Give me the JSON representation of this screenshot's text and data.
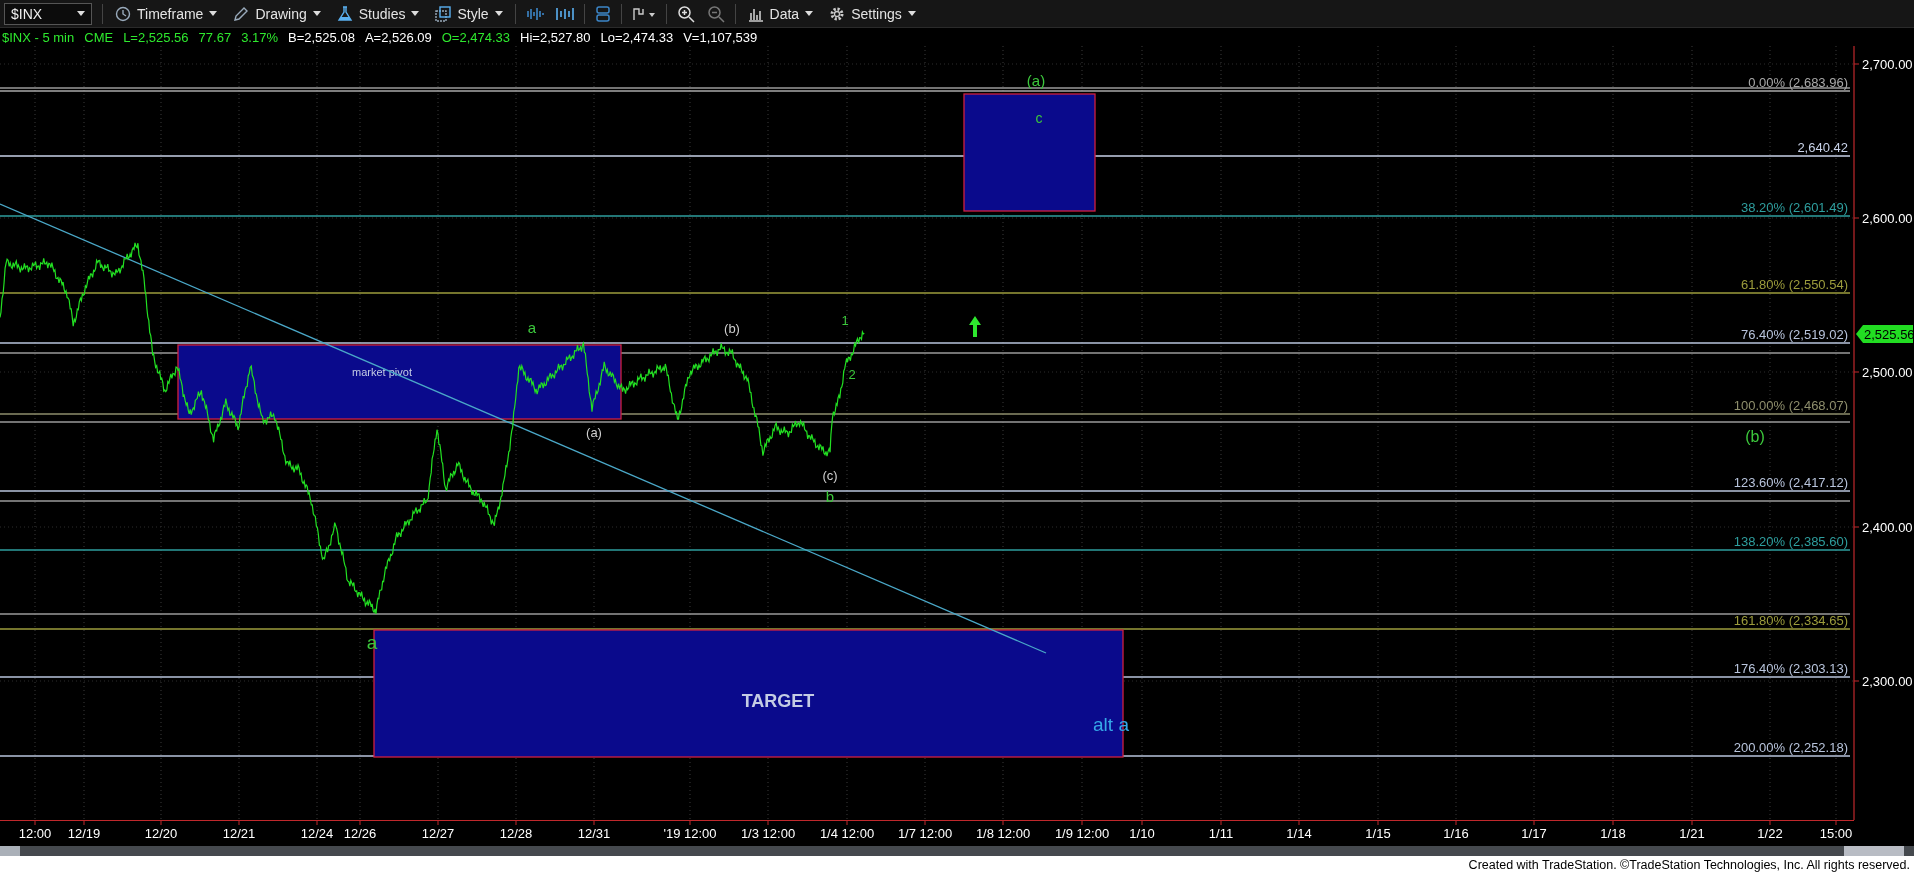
{
  "toolbar": {
    "symbol": "$INX",
    "menus": [
      {
        "label": "Timeframe"
      },
      {
        "label": "Drawing"
      },
      {
        "label": "Studies"
      },
      {
        "label": "Style"
      },
      {
        "label": "Data"
      },
      {
        "label": "Settings"
      }
    ]
  },
  "quote": [
    {
      "text": "$INX - 5 min",
      "color": "#2ee82e"
    },
    {
      "text": "CME",
      "color": "#2ee82e"
    },
    {
      "text": "L=2,525.56",
      "color": "#2ee82e"
    },
    {
      "text": "77.67",
      "color": "#2ee82e"
    },
    {
      "text": "3.17%",
      "color": "#2ee82e"
    },
    {
      "text": "B=2,525.08",
      "color": "#ffffff"
    },
    {
      "text": "A=2,526.09",
      "color": "#ffffff"
    },
    {
      "text": "O=2,474.33",
      "color": "#2ee82e"
    },
    {
      "text": "Hi=2,527.80",
      "color": "#ffffff"
    },
    {
      "text": "Lo=2,474.33",
      "color": "#ffffff"
    },
    {
      "text": "V=1,107,539",
      "color": "#ffffff"
    }
  ],
  "chart": {
    "fib_levels": [
      {
        "label": "0.00% (2,683.96)",
        "color": "#a8a8a8"
      },
      {
        "label": "2,640.42",
        "color": "#c8d2e8"
      },
      {
        "label": "38.20% (2,601.49)",
        "color": "#2e9e9e"
      },
      {
        "label": "61.80% (2,550.54)",
        "color": "#9c9c3c"
      },
      {
        "label": "76.40% (2,519.02)",
        "color": "#b8c4dc"
      },
      {
        "label": "100.00% (2,468.07)",
        "color": "#8e8e6c"
      },
      {
        "label": "123.60% (2,417.12)",
        "color": "#b8c4dc"
      },
      {
        "label": "138.20% (2,385.60)",
        "color": "#2e9e9e"
      },
      {
        "label": "161.80% (2,334.65)",
        "color": "#9c9c3c"
      },
      {
        "label": "176.40% (2,303.13)",
        "color": "#b8c4dc"
      },
      {
        "label": "200.00% (2,252.18)",
        "color": "#b8c4dc"
      }
    ],
    "boxes": [
      {
        "label": "market pivot"
      },
      {
        "label": "c"
      },
      {
        "label": "TARGET"
      }
    ],
    "wave_labels": [
      {
        "text": "(a)",
        "color": "#3cc83c"
      },
      {
        "text": "a",
        "color": "#3cc83c"
      },
      {
        "text": "(b)",
        "color": "#d0d0d0"
      },
      {
        "text": "(a)",
        "color": "#d0d0d0"
      },
      {
        "text": "1",
        "color": "#3cc83c"
      },
      {
        "text": "2",
        "color": "#3cc83c"
      },
      {
        "text": "(c)",
        "color": "#d0d0d0"
      },
      {
        "text": "b",
        "color": "#3cc83c"
      },
      {
        "text": "a",
        "color": "#3cc83c"
      },
      {
        "text": "(b)",
        "color": "#3cc83c"
      },
      {
        "text": "alt a",
        "color": "#35a8e8"
      }
    ],
    "price_axis": [
      "2,700.00",
      "2,600.00",
      "2,500.00",
      "2,400.00",
      "2,300.00"
    ],
    "last_price": "2,525.56",
    "time_axis": [
      "12:00",
      "12/19",
      "12/20",
      "12/21",
      "12/24",
      "12/26",
      "12/27",
      "12/28",
      "12/31",
      "'19 12:00",
      "1/3 12:00",
      "1/4 12:00",
      "1/7 12:00",
      "1/8 12:00",
      "1/9 12:00",
      "1/10",
      "1/11",
      "1/14",
      "1/15",
      "1/16",
      "1/17",
      "1/18",
      "1/21",
      "1/22",
      "15:00"
    ]
  },
  "credit": "Created with TradeStation. ©TradeStation Technologies, Inc. All rights reserved."
}
